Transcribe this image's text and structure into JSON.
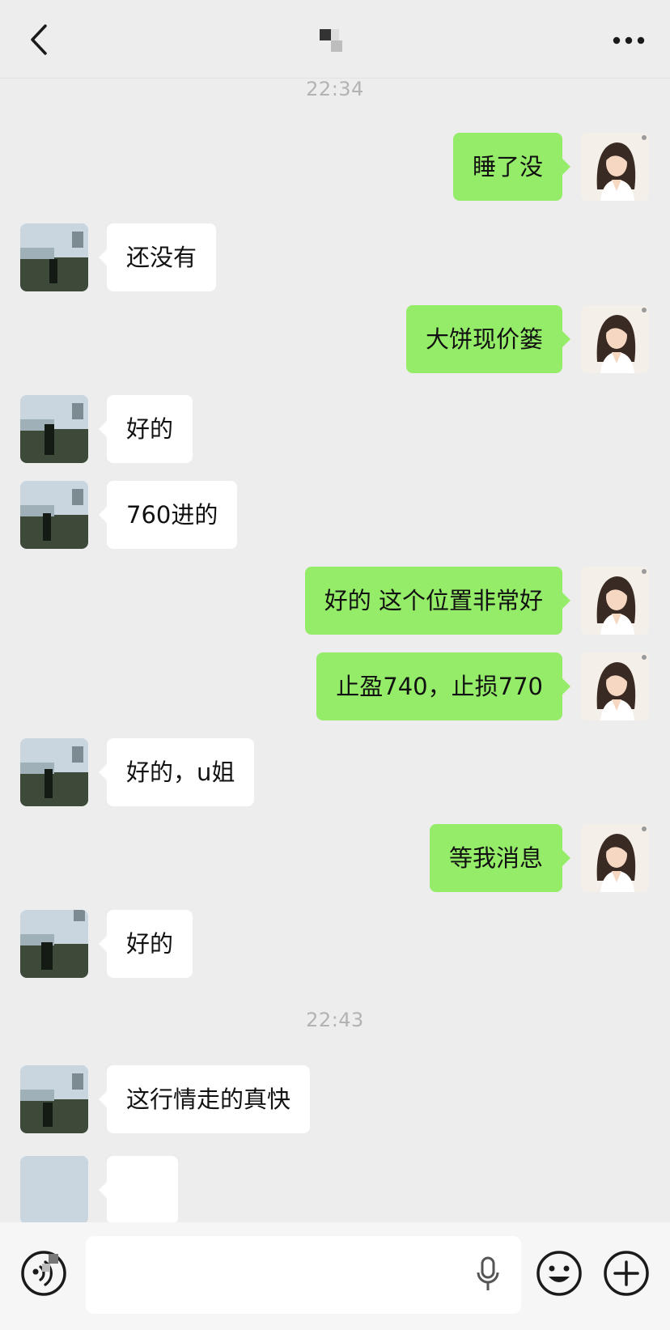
{
  "header": {
    "back_icon": "chevron-left-icon",
    "title": "",
    "more_icon": "more-horizontal-icon"
  },
  "messages": [
    {
      "type": "time",
      "text": "22:34"
    },
    {
      "type": "outgoing",
      "text": "睡了没"
    },
    {
      "type": "incoming",
      "text": "还没有"
    },
    {
      "type": "outgoing",
      "text": "大饼现价篓"
    },
    {
      "type": "incoming",
      "text": "好的"
    },
    {
      "type": "incoming",
      "text": "760进的"
    },
    {
      "type": "outgoing",
      "text": "好的 这个位置非常好"
    },
    {
      "type": "outgoing",
      "text": "止盈740，止损770"
    },
    {
      "type": "incoming",
      "text": "好的，u姐"
    },
    {
      "type": "outgoing",
      "text": "等我消息"
    },
    {
      "type": "incoming",
      "text": "好的"
    },
    {
      "type": "time",
      "text": "22:43"
    },
    {
      "type": "incoming",
      "text": "这行情走的真快"
    }
  ],
  "composer": {
    "voice_icon": "voice-mode-icon",
    "input_value": "",
    "mic_icon": "microphone-icon",
    "emoji_icon": "emoji-icon",
    "plus_icon": "plus-circle-icon"
  },
  "colors": {
    "background": "#ededed",
    "outgoing_bubble": "#95ec69",
    "incoming_bubble": "#ffffff",
    "timestamp": "#b3b3b3"
  }
}
